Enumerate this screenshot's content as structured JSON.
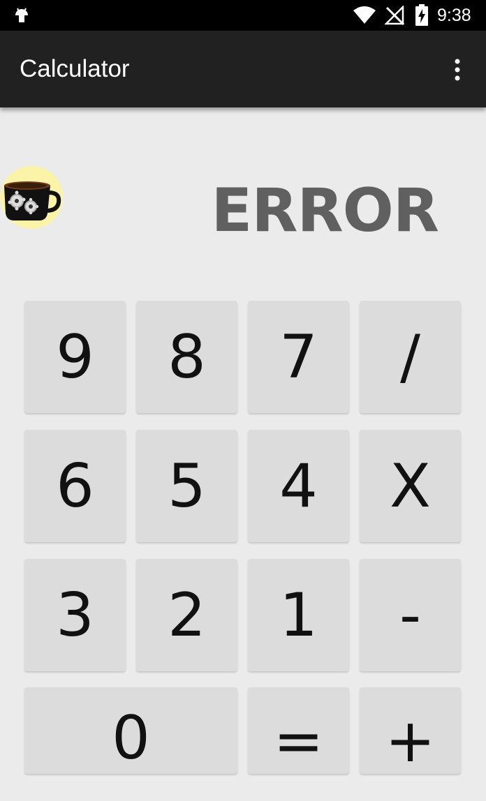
{
  "status_bar": {
    "time": "9:38",
    "icons": [
      "android-icon",
      "wifi-icon",
      "no-signal-icon",
      "battery-charging-icon"
    ]
  },
  "app_bar": {
    "title": "Calculator",
    "overflow_icon": "more-vert-icon"
  },
  "logo": {
    "icon": "coffee-cup-gears-icon"
  },
  "display": {
    "value": "ERROR"
  },
  "keypad": {
    "key_9": "9",
    "key_8": "8",
    "key_7": "7",
    "key_divide": "/",
    "key_6": "6",
    "key_5": "5",
    "key_4": "4",
    "key_multiply": "X",
    "key_3": "3",
    "key_2": "2",
    "key_1": "1",
    "key_minus": "-",
    "key_0": "0",
    "key_equals": "=",
    "key_plus": "+"
  },
  "colors": {
    "status_bar": "#000000",
    "app_bar": "#212121",
    "background": "#ebebeb",
    "key": "#dcdcdc",
    "display_text": "#606060"
  }
}
